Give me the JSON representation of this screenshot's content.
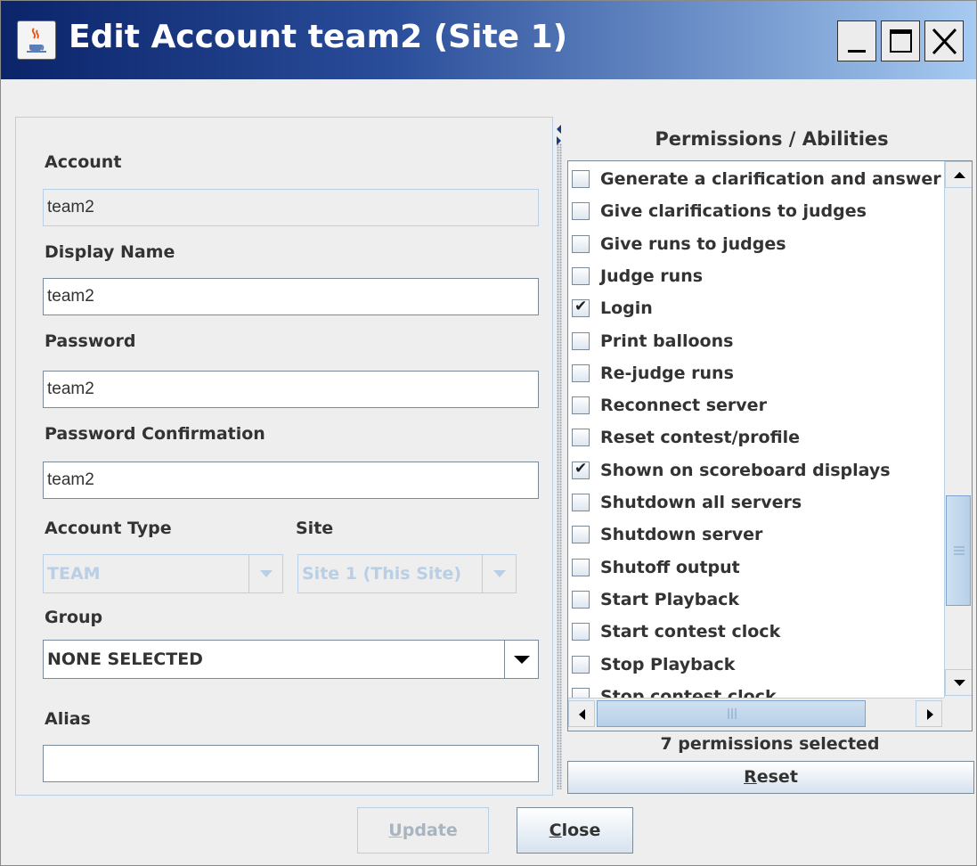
{
  "window": {
    "title": "Edit Account team2 (Site 1)"
  },
  "form": {
    "account_label": "Account",
    "account_value": "team2",
    "display_name_label": "Display Name",
    "display_name_value": "team2",
    "password_label": "Password",
    "password_value": "team2",
    "password_confirm_label": "Password Confirmation",
    "password_confirm_value": "team2",
    "account_type_label": "Account Type",
    "account_type_value": "TEAM",
    "site_label": "Site",
    "site_value": "Site 1 (This Site)",
    "group_label": "Group",
    "group_value": "NONE SELECTED",
    "alias_label": "Alias",
    "alias_value": ""
  },
  "permissions": {
    "title": "Permissions / Abilities",
    "items": [
      {
        "label": "Generate a clarification and answer",
        "checked": false
      },
      {
        "label": "Give clarifications to judges",
        "checked": false
      },
      {
        "label": "Give runs to judges",
        "checked": false
      },
      {
        "label": "Judge runs",
        "checked": false
      },
      {
        "label": "Login",
        "checked": true
      },
      {
        "label": "Print balloons",
        "checked": false
      },
      {
        "label": "Re-judge runs",
        "checked": false
      },
      {
        "label": "Reconnect server",
        "checked": false
      },
      {
        "label": "Reset contest/profile",
        "checked": false
      },
      {
        "label": "Shown on scoreboard displays",
        "checked": true
      },
      {
        "label": "Shutdown all servers",
        "checked": false
      },
      {
        "label": "Shutdown server",
        "checked": false
      },
      {
        "label": "Shutoff output",
        "checked": false
      },
      {
        "label": "Start Playback",
        "checked": false
      },
      {
        "label": "Start contest clock",
        "checked": false
      },
      {
        "label": "Stop Playback",
        "checked": false
      },
      {
        "label": "Stop contest clock",
        "checked": false
      }
    ],
    "count_text": "7 permissions selected",
    "reset_prefix": "R",
    "reset_rest": "eset"
  },
  "buttons": {
    "update_prefix": "U",
    "update_rest": "pdate",
    "close_prefix": "C",
    "close_rest": "lose"
  },
  "icons": {
    "app": "java-coffee-cup-icon",
    "minimize": "minimize-icon",
    "maximize": "maximize-icon",
    "close": "close-icon"
  }
}
